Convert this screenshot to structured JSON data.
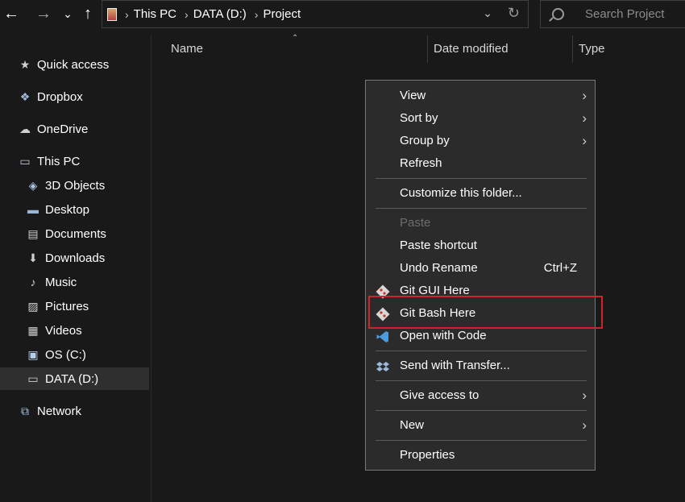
{
  "toolbar": {
    "back_icon": "←",
    "forward_icon": "→",
    "recent_icon": "⌄",
    "up_icon": "↑",
    "breadcrumb": [
      "This PC",
      "DATA (D:)",
      "Project"
    ],
    "search_placeholder": "Search Project"
  },
  "sidebar": {
    "quick_access": "Quick access",
    "dropbox": "Dropbox",
    "onedrive": "OneDrive",
    "this_pc": "This PC",
    "objects_3d": "3D Objects",
    "desktop": "Desktop",
    "documents": "Documents",
    "downloads": "Downloads",
    "music": "Music",
    "pictures": "Pictures",
    "videos": "Videos",
    "os_c": "OS (C:)",
    "data_d": "DATA (D:)",
    "network": "Network"
  },
  "columns": {
    "name": "Name",
    "date_modified": "Date modified",
    "type": "Type"
  },
  "context_menu": {
    "view": "View",
    "sort_by": "Sort by",
    "group_by": "Group by",
    "refresh": "Refresh",
    "customize": "Customize this folder...",
    "paste": "Paste",
    "paste_shortcut": "Paste shortcut",
    "undo_rename": "Undo Rename",
    "undo_shortcut": "Ctrl+Z",
    "git_gui": "Git GUI Here",
    "git_bash": "Git Bash Here",
    "open_with_code": "Open with Code",
    "send_with_transfer": "Send with Transfer...",
    "give_access": "Give access to",
    "new": "New",
    "properties": "Properties"
  },
  "colors": {
    "background": "#191919",
    "menu_background": "#2b2b2b",
    "highlight_border": "#d3222a"
  }
}
